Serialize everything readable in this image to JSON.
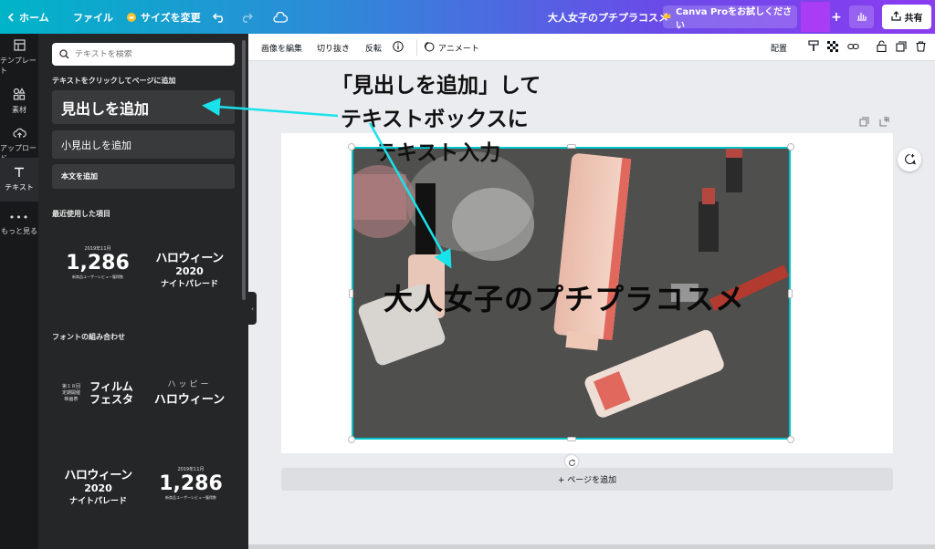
{
  "topbar": {
    "home_label": "ホーム",
    "file_label": "ファイル",
    "resize_label": "サイズを変更",
    "doc_title": "大人女子のプチプラコスメ",
    "pro_label": "Canva Proをお試しください",
    "share_label": "共有"
  },
  "rail": {
    "items": [
      {
        "label": "テンプレート"
      },
      {
        "label": "素材"
      },
      {
        "label": "アップロード"
      },
      {
        "label": "テキスト"
      },
      {
        "label": "もっと見る"
      }
    ]
  },
  "panel": {
    "search_placeholder": "テキストを検索",
    "click_add_title": "テキストをクリックしてページに追加",
    "heading_label": "見出しを追加",
    "subheading_label": "小見出しを追加",
    "body_label": "本文を追加",
    "recent_title": "最近使用した項目",
    "font_combo_title": "フォントの組み合わせ",
    "templates": [
      {
        "top": "2019年11月",
        "main": "1,286",
        "bottom": "新商品ユーザーレビュー獲得数"
      },
      {
        "main": "ハロウィーン",
        "sub": "2020",
        "bottom": "ナイトパレード"
      },
      {
        "left": "第１８回 定期開催 映画祭",
        "main": "フィルム フェスタ"
      },
      {
        "top": "ハッピー",
        "main": "ハロウィーン"
      },
      {
        "main": "ハロウィーン",
        "sub": "2020",
        "bottom": "ナイトパレード"
      },
      {
        "top": "2019年11月",
        "main": "1,286",
        "bottom": "新商品ユーザーレビュー獲得数"
      }
    ]
  },
  "toolbar": {
    "edit_image": "画像を編集",
    "crop": "切り抜き",
    "flip": "反転",
    "animate": "アニメート",
    "arrange": "配置"
  },
  "canvas": {
    "title_text": "大人女子のプチプラコスメ",
    "add_page": "+ ページを追加"
  },
  "annotation": {
    "line1": "「見出しを追加」して",
    "line2": "テキストボックスに",
    "line3": "テキスト入力",
    "arrow_color": "#19e3ea"
  },
  "colors": {
    "accent": "#00c4cc",
    "panel_bg": "#252627",
    "rail_bg": "#18191b"
  }
}
